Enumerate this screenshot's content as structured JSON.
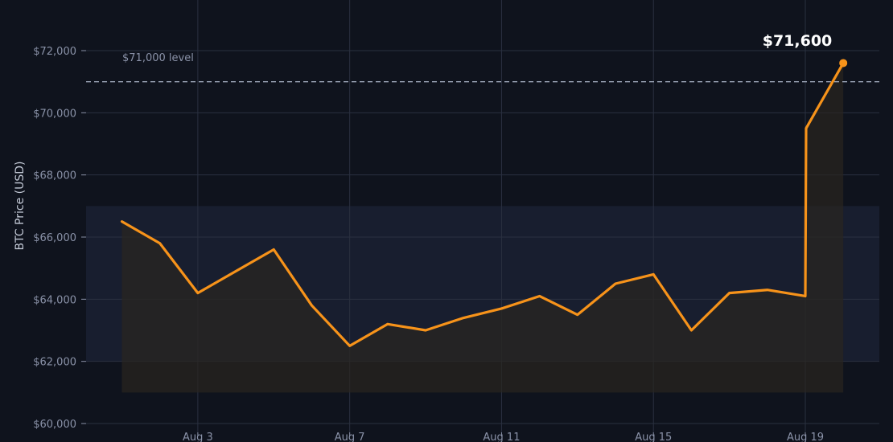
{
  "chart_data": {
    "type": "line",
    "ylabel": "BTC Price (USD)",
    "xlabel": "",
    "ylim": [
      60000,
      73000
    ],
    "y_ticks": [
      60000,
      62000,
      64000,
      66000,
      68000,
      70000,
      72000
    ],
    "y_tick_labels": [
      "$60,000",
      "$62,000",
      "$64,000",
      "$66,000",
      "$68,000",
      "$70,000",
      "$72,000"
    ],
    "x_ticks": [
      "2024-08-03",
      "2024-08-07",
      "2024-08-11",
      "2024-08-15",
      "2024-08-19"
    ],
    "x_tick_labels": [
      "Aug 3",
      "Aug 7",
      "Aug 11",
      "Aug 15",
      "Aug 19"
    ],
    "grid": true,
    "series": [
      {
        "color": "#f7931a",
        "points": [
          {
            "x": "2024-08-01",
            "y": 66500
          },
          {
            "x": "2024-08-02",
            "y": 65800
          },
          {
            "x": "2024-08-03",
            "y": 64200
          },
          {
            "x": "2024-08-04",
            "y": 64900
          },
          {
            "x": "2024-08-05",
            "y": 65600
          },
          {
            "x": "2024-08-06",
            "y": 63800
          },
          {
            "x": "2024-08-07",
            "y": 62500
          },
          {
            "x": "2024-08-08",
            "y": 63200
          },
          {
            "x": "2024-08-09",
            "y": 63000
          },
          {
            "x": "2024-08-10",
            "y": 63400
          },
          {
            "x": "2024-08-11",
            "y": 63700
          },
          {
            "x": "2024-08-12",
            "y": 64100
          },
          {
            "x": "2024-08-13",
            "y": 63500
          },
          {
            "x": "2024-08-14",
            "y": 64500
          },
          {
            "x": "2024-08-15",
            "y": 64800
          },
          {
            "x": "2024-08-16",
            "y": 63000
          },
          {
            "x": "2024-08-17",
            "y": 64200
          },
          {
            "x": "2024-08-18",
            "y": 64300
          },
          {
            "x": "2024-08-19",
            "y": 64100
          },
          {
            "x": "2024-08-19T00:30",
            "y": 69500
          },
          {
            "x": "2024-08-20",
            "y": 71600
          }
        ]
      }
    ],
    "reference_line": {
      "y": 71000,
      "label": "$71,000 level",
      "color": "#9aa3b5"
    },
    "shaded_band": {
      "y_range": [
        62000,
        67000
      ],
      "color": "#1c2336"
    },
    "area_fill": {
      "y_base": 61000,
      "color": "#2a2520"
    },
    "callout": {
      "text": "$71,600",
      "x": "2024-08-20",
      "y": 71600
    }
  }
}
